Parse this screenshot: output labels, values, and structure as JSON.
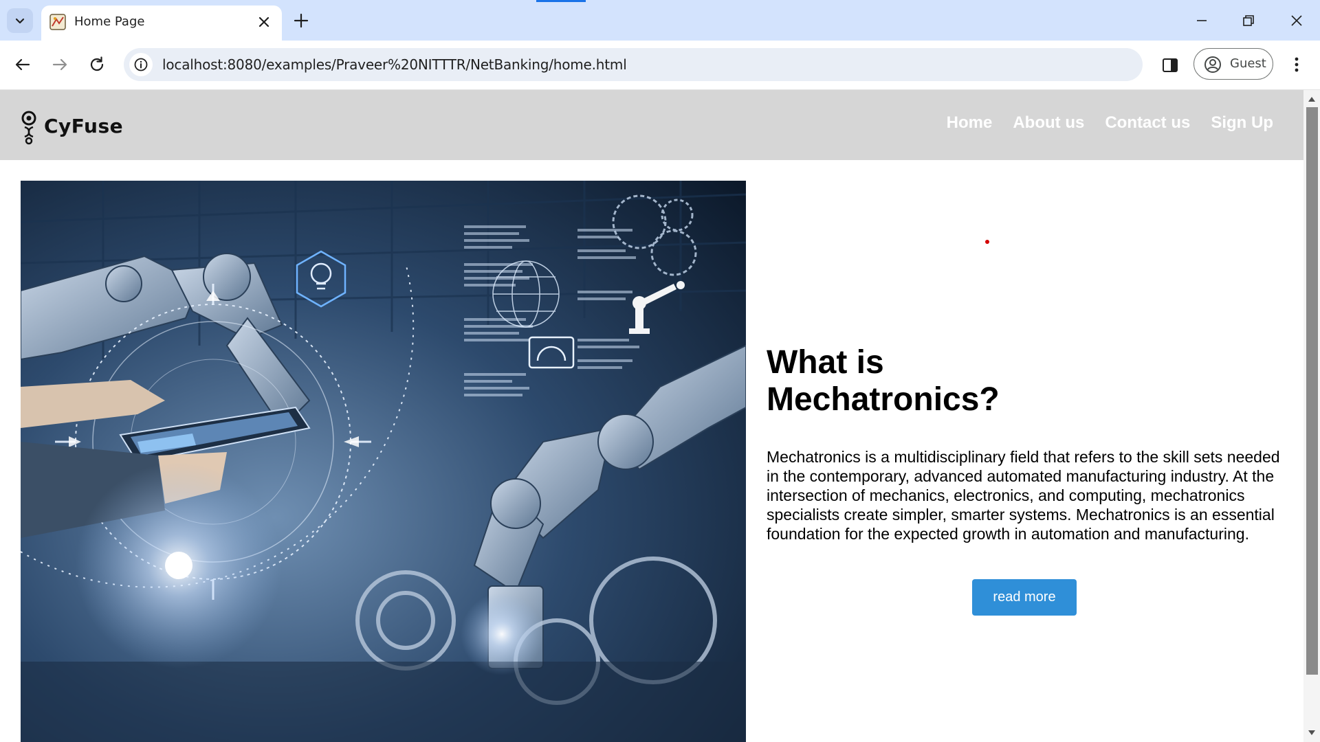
{
  "browser": {
    "tab_title": "Home Page",
    "url": "localhost:8080/examples/Praveer%20NITTTR/NetBanking/home.html",
    "profile_label": "Guest"
  },
  "site": {
    "brand": "CyFuse",
    "nav": [
      "Home",
      "About us",
      "Contact us",
      "Sign Up"
    ]
  },
  "main": {
    "headline": "What is Mechatronics?",
    "body": "Mechatronics is a multidisciplinary field that refers to the skill sets needed in the contemporary, advanced automated manufacturing industry. At the intersection of mechanics, electronics, and computing, mechatronics specialists create simpler, smarter systems. Mechatronics is an essential foundation for the expected growth in automation and manufacturing.",
    "cta_label": "read more"
  },
  "colors": {
    "accent": "#2f8fd8",
    "nav_background": "#d6d6d6",
    "tabstrip": "#d3e3fd"
  }
}
